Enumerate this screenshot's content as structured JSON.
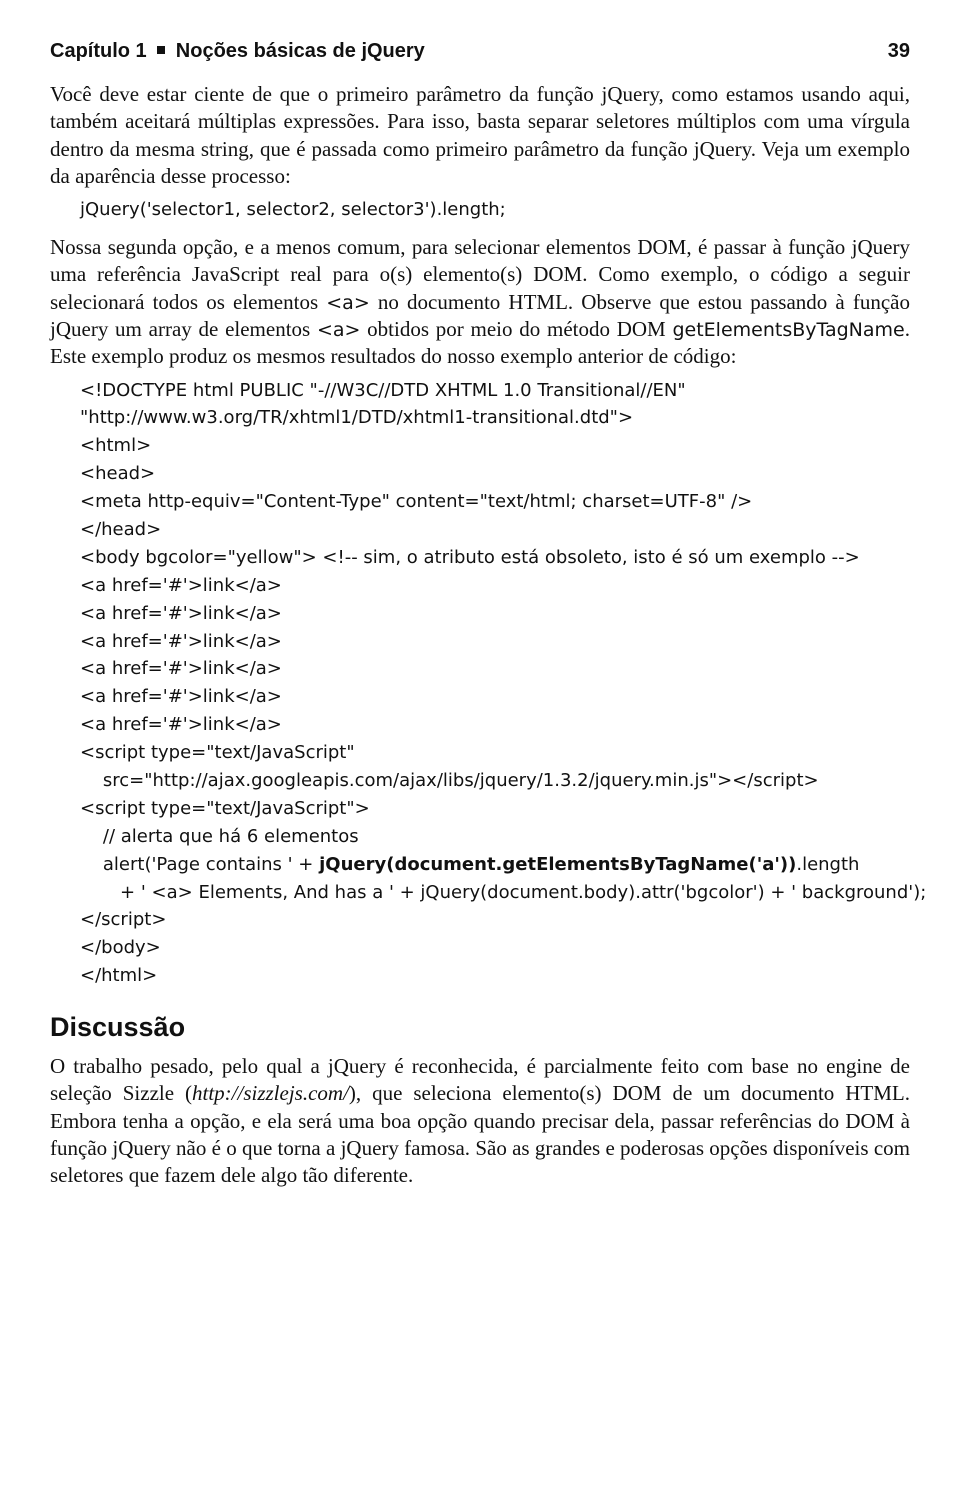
{
  "header": {
    "chapter_label": "Capítulo 1",
    "chapter_title": "Noções básicas de jQuery",
    "page_number": "39"
  },
  "paragraphs": {
    "p1_a": "Você deve estar ciente de que o primeiro parâmetro da função jQuery, como estamos usando aqui, também aceitará múltiplas expressões. Para isso, basta separar seletores múltiplos com uma vírgula dentro da mesma string, que é passada como primeiro parâmetro da função jQuery. Veja um exemplo da aparência desse processo:",
    "code1": "jQuery('selector1, selector2, selector3').length;",
    "p2_a": "Nossa segunda opção, e a menos comum, para selecionar elementos DOM, é passar à função jQuery uma referência JavaScript real para o(s) elemento(s) DOM. Como exemplo, o código a seguir selecionará todos os elementos ",
    "p2_code_a": "<a>",
    "p2_b": " no documento HTML. Observe que estou passando à função jQuery um array de elementos ",
    "p2_code_b": "<a>",
    "p2_c": " obtidos por meio do método DOM ",
    "p2_code_c": "getElementsByTagName",
    "p2_d": ". Este exemplo produz os mesmos resultados do nosso exemplo anterior de código:",
    "codeblock": {
      "l01": "<!DOCTYPE html PUBLIC \"-//W3C//DTD XHTML 1.0 Transitional//EN\"",
      "l02": "\"http://www.w3.org/TR/xhtml1/DTD/xhtml1-transitional.dtd\">",
      "l03": "<html>",
      "l04": "<head>",
      "l05": "<meta http-equiv=\"Content-Type\" content=\"text/html; charset=UTF-8\" />",
      "l06": "</head>",
      "l07": "<body bgcolor=\"yellow\"> <!-- sim, o atributo está obsoleto, isto é só um exemplo -->",
      "l08": "<a href='#'>link</a>",
      "l09": "<a href='#'>link</a>",
      "l10": "<a href='#'>link</a>",
      "l11": "<a href='#'>link</a>",
      "l12": "<a href='#'>link</a>",
      "l13": "<a href='#'>link</a>",
      "l14": "<script type=\"text/JavaScript\"",
      "l15": "    src=\"http://ajax.googleapis.com/ajax/libs/jquery/1.3.2/jquery.min.js\"></scr",
      "l15b": "ipt>",
      "l16": "<script type=\"text/JavaScript\">",
      "l17": "    // alerta que há 6 elementos",
      "l18a": "    alert('Page contains ' + ",
      "l18b": "jQuery(document.getElementsByTagName('a'))",
      "l18c": ".length",
      "l19": "       + ' <a> Elements, And has a ' + jQuery(document.body).attr('bgcolor') + ' background');",
      "l20": "</scr",
      "l20b": "ipt>",
      "l21": "</body>",
      "l22": "</html>"
    },
    "section_title": "Discussão",
    "p3_a": "O trabalho pesado, pelo qual a jQuery é reconhecida, é parcialmente feito com base no engine de seleção Sizzle (",
    "p3_link": "http://sizzlejs.com/",
    "p3_b": "), que seleciona elemento(s) DOM de um documento HTML. Embora tenha a opção, e ela será uma boa opção quando precisar dela, passar referências do DOM à função jQuery não é o que torna a jQuery famosa. São as grandes e poderosas opções disponíveis com seletores que fazem dele algo tão diferente."
  }
}
